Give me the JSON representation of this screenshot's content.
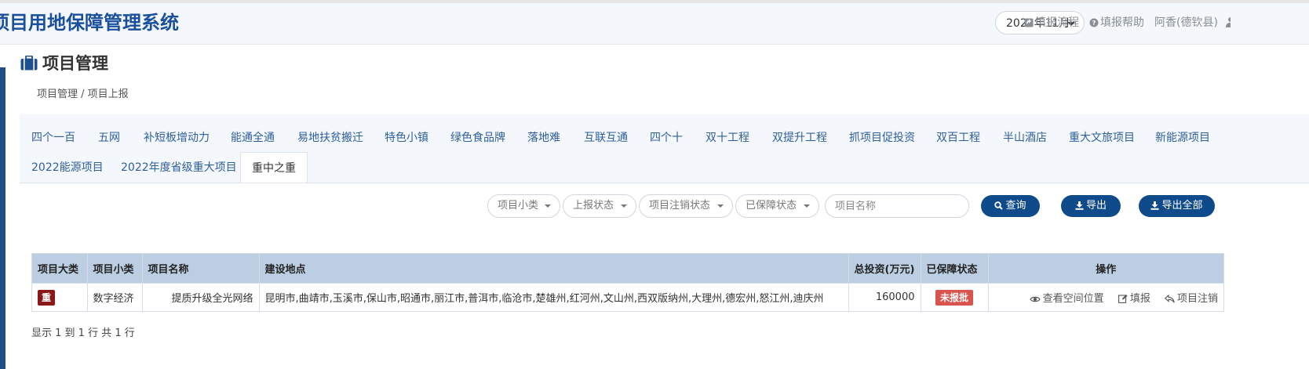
{
  "header": {
    "system_title": "项目用地保障管理系统",
    "month_select": "2022年11月",
    "links": {
      "process": "填报流程",
      "help": "填报帮助",
      "user": "阿香(德钦县)"
    }
  },
  "page": {
    "title": "项目管理",
    "breadcrumb": "项目管理 / 项目上报"
  },
  "tabs": {
    "row1": [
      "四个一百",
      "五网",
      "补短板增动力",
      "能通全通",
      "易地扶贫搬迁",
      "特色小镇",
      "绿色食品牌",
      "落地难",
      "互联互通",
      "四个十",
      "双十工程",
      "双提升工程",
      "抓项目促投资",
      "双百工程",
      "半山酒店",
      "重大文旅项目",
      "新能源项目"
    ],
    "row2": [
      "2022能源项目",
      "2022年度省级重大项目",
      "重中之重"
    ],
    "active": "重中之重"
  },
  "filters": {
    "sub_category": "项目小类",
    "report_status": "上报状态",
    "cancel_status": "项目注销状态",
    "guarantee_status": "已保障状态",
    "name_placeholder": "项目名称",
    "query_button": "查询",
    "export_button": "导出",
    "export_all_button": "导出全部"
  },
  "table": {
    "headers": [
      "项目大类",
      "项目小类",
      "项目名称",
      "建设地点",
      "总投资(万元)",
      "已保障状态",
      "操作"
    ],
    "rows": [
      {
        "category": "重",
        "sub_category": "数字经济",
        "name": "提质升级全光网络",
        "location": "昆明市,曲靖市,玉溪市,保山市,昭通市,丽江市,普洱市,临沧市,楚雄州,红河州,文山州,西双版纳州,大理州,德宏州,怒江州,迪庆州",
        "investment": "160000",
        "status": "未报批",
        "ops": [
          "查看空间位置",
          "填报",
          "项目注销"
        ]
      }
    ]
  },
  "summary": "显示 1 到 1 行 共 1 行",
  "colors": {
    "brand": "#1a4f9c",
    "button": "#0f4a8a",
    "table_header": "#bccfe2",
    "category_badge": "#8b1818",
    "status_badge": "#d9534f"
  }
}
